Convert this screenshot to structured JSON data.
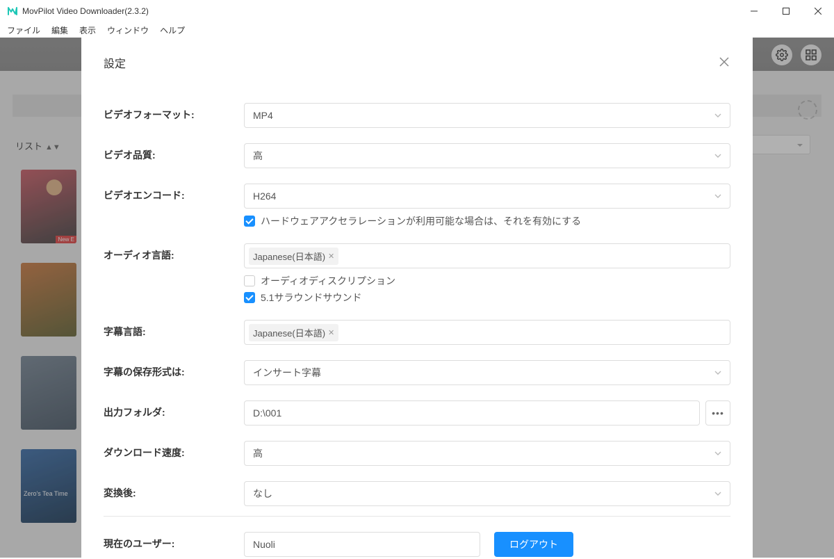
{
  "window": {
    "title": "MovPilot Video Downloader(2.3.2)"
  },
  "menubar": {
    "items": [
      "ファイル",
      "編集",
      "表示",
      "ウィンドウ",
      "ヘルプ"
    ]
  },
  "background": {
    "list_label": "リスト",
    "thumb4_text": "Zero's\nTea Time"
  },
  "dialog": {
    "title": "設定",
    "labels": {
      "video_format": "ビデオフォーマット:",
      "video_quality": "ビデオ品質:",
      "video_encode": "ビデオエンコード:",
      "audio_lang": "オーディオ言語:",
      "subtitle_lang": "字幕言語:",
      "subtitle_save": "字幕の保存形式は:",
      "output_folder": "出力フォルダ:",
      "download_speed": "ダウンロード速度:",
      "after_convert": "変換後:",
      "current_user": "現在のユーザー:"
    },
    "values": {
      "video_format": "MP4",
      "video_quality": "高",
      "video_encode": "H264",
      "hw_accel_label": "ハードウェアアクセラレーションが利用可能な場合は、それを有効にする",
      "audio_tag": "Japanese(日本語)",
      "audio_desc_label": "オーディオディスクリプション",
      "surround_label": "5.1サラウンドサウンド",
      "subtitle_tag": "Japanese(日本語)",
      "subtitle_save": "インサート字幕",
      "output_folder": "D:\\001",
      "download_speed": "高",
      "after_convert": "なし",
      "current_user": "Nuoli",
      "logout": "ログアウト"
    },
    "checks": {
      "hw_accel": true,
      "audio_desc": false,
      "surround": true
    }
  }
}
